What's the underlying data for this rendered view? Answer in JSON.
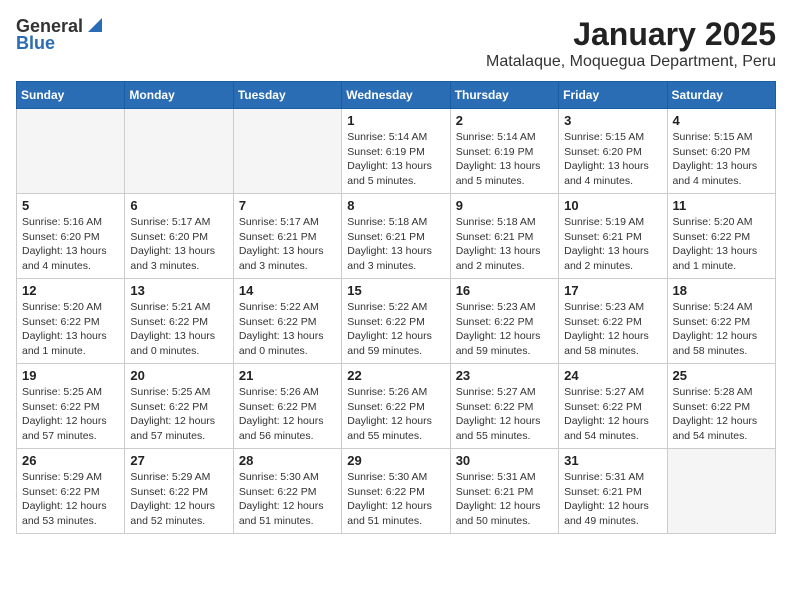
{
  "logo": {
    "general": "General",
    "blue": "Blue"
  },
  "title": "January 2025",
  "subtitle": "Matalaque, Moquegua Department, Peru",
  "days_of_week": [
    "Sunday",
    "Monday",
    "Tuesday",
    "Wednesday",
    "Thursday",
    "Friday",
    "Saturday"
  ],
  "weeks": [
    [
      {
        "day": "",
        "info": ""
      },
      {
        "day": "",
        "info": ""
      },
      {
        "day": "",
        "info": ""
      },
      {
        "day": "1",
        "info": "Sunrise: 5:14 AM\nSunset: 6:19 PM\nDaylight: 13 hours\nand 5 minutes."
      },
      {
        "day": "2",
        "info": "Sunrise: 5:14 AM\nSunset: 6:19 PM\nDaylight: 13 hours\nand 5 minutes."
      },
      {
        "day": "3",
        "info": "Sunrise: 5:15 AM\nSunset: 6:20 PM\nDaylight: 13 hours\nand 4 minutes."
      },
      {
        "day": "4",
        "info": "Sunrise: 5:15 AM\nSunset: 6:20 PM\nDaylight: 13 hours\nand 4 minutes."
      }
    ],
    [
      {
        "day": "5",
        "info": "Sunrise: 5:16 AM\nSunset: 6:20 PM\nDaylight: 13 hours\nand 4 minutes."
      },
      {
        "day": "6",
        "info": "Sunrise: 5:17 AM\nSunset: 6:20 PM\nDaylight: 13 hours\nand 3 minutes."
      },
      {
        "day": "7",
        "info": "Sunrise: 5:17 AM\nSunset: 6:21 PM\nDaylight: 13 hours\nand 3 minutes."
      },
      {
        "day": "8",
        "info": "Sunrise: 5:18 AM\nSunset: 6:21 PM\nDaylight: 13 hours\nand 3 minutes."
      },
      {
        "day": "9",
        "info": "Sunrise: 5:18 AM\nSunset: 6:21 PM\nDaylight: 13 hours\nand 2 minutes."
      },
      {
        "day": "10",
        "info": "Sunrise: 5:19 AM\nSunset: 6:21 PM\nDaylight: 13 hours\nand 2 minutes."
      },
      {
        "day": "11",
        "info": "Sunrise: 5:20 AM\nSunset: 6:22 PM\nDaylight: 13 hours\nand 1 minute."
      }
    ],
    [
      {
        "day": "12",
        "info": "Sunrise: 5:20 AM\nSunset: 6:22 PM\nDaylight: 13 hours\nand 1 minute."
      },
      {
        "day": "13",
        "info": "Sunrise: 5:21 AM\nSunset: 6:22 PM\nDaylight: 13 hours\nand 0 minutes."
      },
      {
        "day": "14",
        "info": "Sunrise: 5:22 AM\nSunset: 6:22 PM\nDaylight: 13 hours\nand 0 minutes."
      },
      {
        "day": "15",
        "info": "Sunrise: 5:22 AM\nSunset: 6:22 PM\nDaylight: 12 hours\nand 59 minutes."
      },
      {
        "day": "16",
        "info": "Sunrise: 5:23 AM\nSunset: 6:22 PM\nDaylight: 12 hours\nand 59 minutes."
      },
      {
        "day": "17",
        "info": "Sunrise: 5:23 AM\nSunset: 6:22 PM\nDaylight: 12 hours\nand 58 minutes."
      },
      {
        "day": "18",
        "info": "Sunrise: 5:24 AM\nSunset: 6:22 PM\nDaylight: 12 hours\nand 58 minutes."
      }
    ],
    [
      {
        "day": "19",
        "info": "Sunrise: 5:25 AM\nSunset: 6:22 PM\nDaylight: 12 hours\nand 57 minutes."
      },
      {
        "day": "20",
        "info": "Sunrise: 5:25 AM\nSunset: 6:22 PM\nDaylight: 12 hours\nand 57 minutes."
      },
      {
        "day": "21",
        "info": "Sunrise: 5:26 AM\nSunset: 6:22 PM\nDaylight: 12 hours\nand 56 minutes."
      },
      {
        "day": "22",
        "info": "Sunrise: 5:26 AM\nSunset: 6:22 PM\nDaylight: 12 hours\nand 55 minutes."
      },
      {
        "day": "23",
        "info": "Sunrise: 5:27 AM\nSunset: 6:22 PM\nDaylight: 12 hours\nand 55 minutes."
      },
      {
        "day": "24",
        "info": "Sunrise: 5:27 AM\nSunset: 6:22 PM\nDaylight: 12 hours\nand 54 minutes."
      },
      {
        "day": "25",
        "info": "Sunrise: 5:28 AM\nSunset: 6:22 PM\nDaylight: 12 hours\nand 54 minutes."
      }
    ],
    [
      {
        "day": "26",
        "info": "Sunrise: 5:29 AM\nSunset: 6:22 PM\nDaylight: 12 hours\nand 53 minutes."
      },
      {
        "day": "27",
        "info": "Sunrise: 5:29 AM\nSunset: 6:22 PM\nDaylight: 12 hours\nand 52 minutes."
      },
      {
        "day": "28",
        "info": "Sunrise: 5:30 AM\nSunset: 6:22 PM\nDaylight: 12 hours\nand 51 minutes."
      },
      {
        "day": "29",
        "info": "Sunrise: 5:30 AM\nSunset: 6:22 PM\nDaylight: 12 hours\nand 51 minutes."
      },
      {
        "day": "30",
        "info": "Sunrise: 5:31 AM\nSunset: 6:21 PM\nDaylight: 12 hours\nand 50 minutes."
      },
      {
        "day": "31",
        "info": "Sunrise: 5:31 AM\nSunset: 6:21 PM\nDaylight: 12 hours\nand 49 minutes."
      },
      {
        "day": "",
        "info": ""
      }
    ]
  ]
}
